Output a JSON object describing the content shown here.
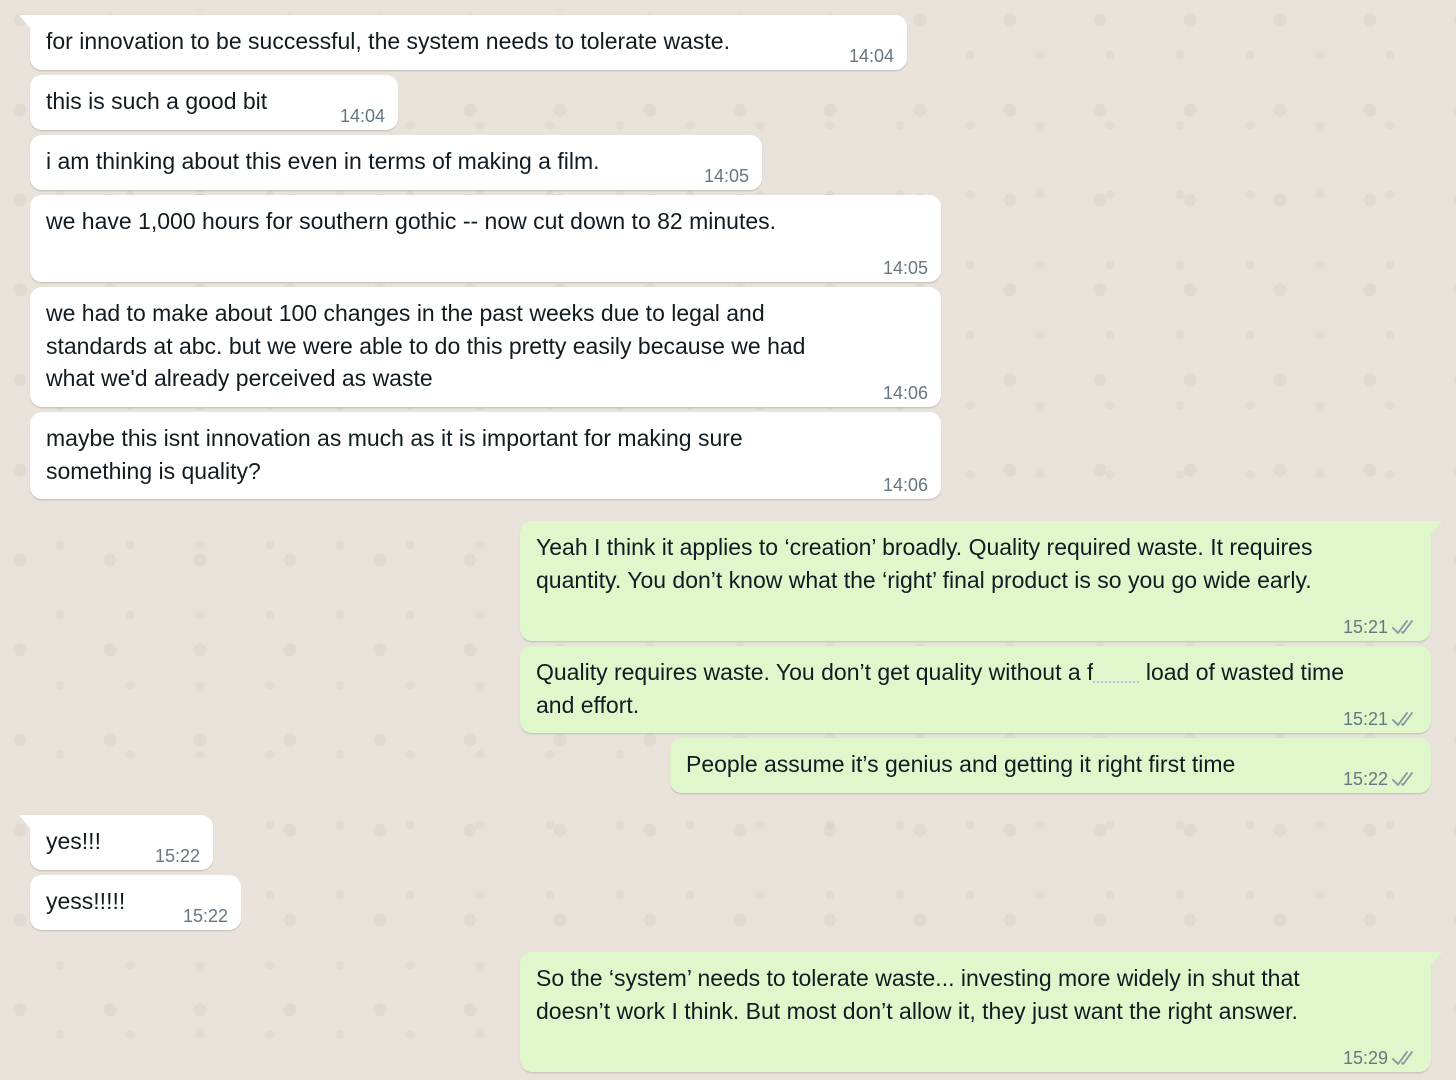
{
  "messages": [
    {
      "text": "for innovation to be successful, the system needs to tolerate waste.",
      "time": "14:04"
    },
    {
      "text": "this is such a good bit",
      "time": "14:04"
    },
    {
      "text": "i am thinking about this even in terms of making a film.",
      "time": "14:05"
    },
    {
      "text": "we have 1,000 hours for southern gothic -- now cut down to 82 minutes.",
      "time": "14:05"
    },
    {
      "text": "we had to make about 100 changes in the past weeks due to legal and\nstandards at abc. but we were able to do this pretty easily because we had\nwhat we'd already perceived as waste",
      "time": "14:06"
    },
    {
      "text": "maybe this isnt innovation as much as it is important for making sure\nsomething is quality?",
      "time": "14:06"
    },
    {
      "text": "Yeah I think it applies to ‘creation’ broadly. Quality required waste. It requires\nquantity. You don’t know what the ‘right’ final product is so you go wide early.",
      "time": "15:21"
    },
    {
      "text_before": "Quality requires waste. You don’t get quality without a f",
      "text_after": " load of wasted time\nand effort.",
      "time": "15:21"
    },
    {
      "text": "People assume it’s genius and getting it right first time",
      "time": "15:22"
    },
    {
      "text": "yes!!!",
      "time": "15:22"
    },
    {
      "text": "yess!!!!!",
      "time": "15:22"
    },
    {
      "text": "So the ‘system’ needs to tolerate waste... investing more widely in shut that\ndoesn’t work I think. But most don’t allow it, they just want the right answer.",
      "time": "15:29"
    }
  ],
  "colors": {
    "incoming_bubble": "#ffffff",
    "outgoing_bubble": "#e0f7cc",
    "background": "#e8e2da",
    "timestamp": "#667781",
    "read_check": "#8696a0"
  },
  "icons": {
    "read_receipt": "double-check-icon"
  }
}
